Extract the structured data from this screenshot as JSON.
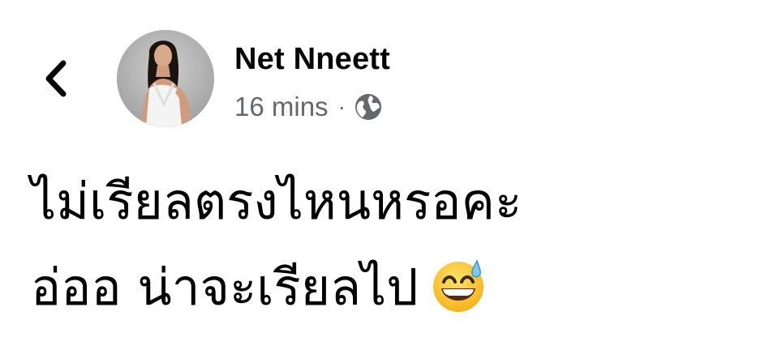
{
  "post": {
    "author_name": "Net Nneett",
    "timestamp": "16 mins",
    "separator": "·",
    "privacy_icon": "globe-icon",
    "lines": [
      "ไม่เรียลตรงไหนหรอคะ",
      "อ่ออ น่าจะเรียลไป"
    ],
    "emoji": "grinning-face-with-sweat-icon"
  },
  "nav": {
    "back_icon": "chevron-left-icon"
  }
}
